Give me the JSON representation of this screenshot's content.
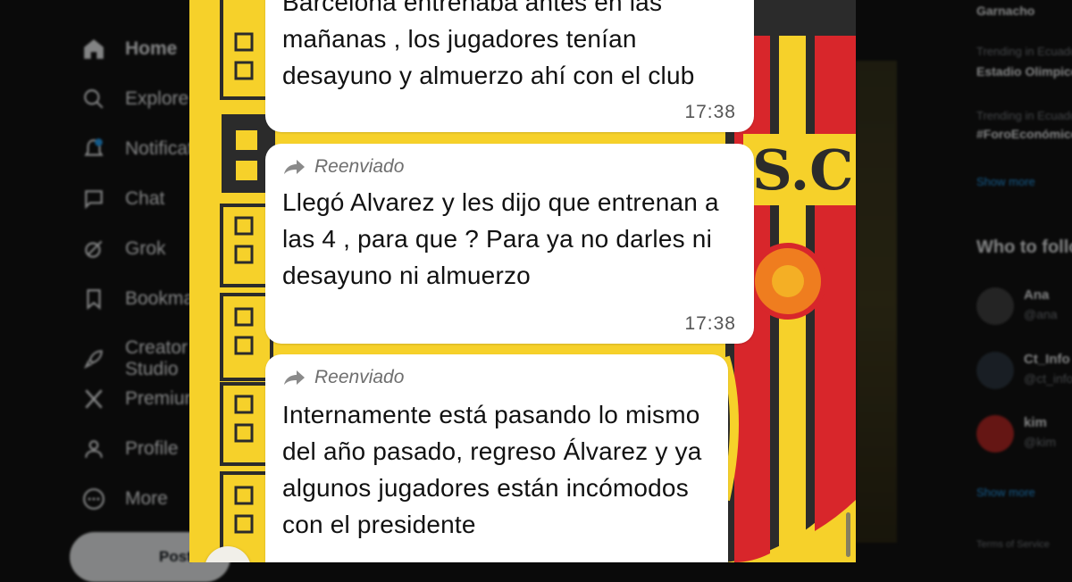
{
  "sidebar": {
    "items": [
      {
        "label": "Home",
        "icon": "home-icon"
      },
      {
        "label": "Explore",
        "icon": "search-icon"
      },
      {
        "label": "Notifications",
        "icon": "bell-icon",
        "badge": "1"
      },
      {
        "label": "Chat",
        "icon": "chat-icon"
      },
      {
        "label": "Grok",
        "icon": "grok-icon"
      },
      {
        "label": "Bookmarks",
        "icon": "bookmark-icon"
      },
      {
        "label": "Creator Studio",
        "icon": "rocket-icon"
      },
      {
        "label": "Premium",
        "icon": "x-logo-icon"
      },
      {
        "label": "Profile",
        "icon": "person-icon"
      },
      {
        "label": "More",
        "icon": "more-icon"
      }
    ],
    "post_label": "Post"
  },
  "right_panel": {
    "trend_top": "Garnacho",
    "trend_2_meta": "Trending in Ecuador",
    "trend_2": "Estadio Olimpico",
    "trend_3_meta": "Trending in Ecuador",
    "trend_3": "#ForoEconómico",
    "show_more": "Show more",
    "who_to_follow": "Who to follow",
    "follow": [
      {
        "name": "Ana",
        "handle": "@ana"
      },
      {
        "name": "Ct_Info",
        "handle": "@ct_info"
      },
      {
        "name": "kim",
        "handle": "@kim"
      }
    ],
    "show_more_2": "Show more",
    "footer": "Terms of Service"
  },
  "chat": {
    "messages": [
      {
        "forwarded": false,
        "forward_label": "",
        "text_partial_top": "Barcelona entrenaba antes en las",
        "text": "mañanas , los jugadores tenían desayuno y almuerzo ahí con el club",
        "time": "17:38"
      },
      {
        "forwarded": true,
        "forward_label": "Reenviado",
        "text": "Llegó Alvarez y les dijo que entrenan a las 4 , para que ? Para ya no darles ni desayuno ni almuerzo",
        "time": "17:38"
      },
      {
        "forwarded": true,
        "forward_label": "Reenviado",
        "text": "Internamente está pasando lo mismo del año pasado, regreso Álvarez y ya algunos jugadores están incómodos con el presidente",
        "time": ""
      }
    ],
    "wallpaper_colors": {
      "yellow": "#f6d12a",
      "dark": "#2b2b2b",
      "red": "#d8262b",
      "orange": "#ef7d1f"
    }
  }
}
